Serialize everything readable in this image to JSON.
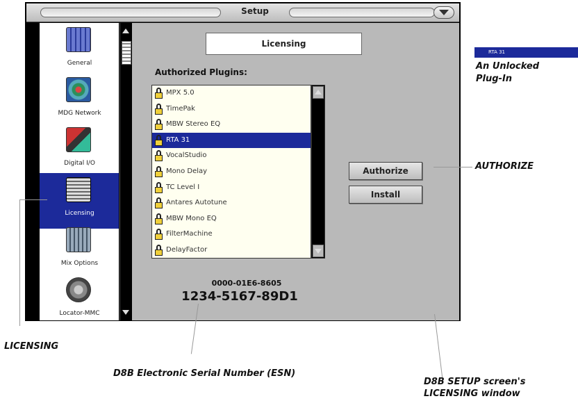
{
  "window": {
    "title": "Setup"
  },
  "sidebar": {
    "items": [
      {
        "label": "General",
        "icon": "general-icon"
      },
      {
        "label": "MDG Network",
        "icon": "network-icon"
      },
      {
        "label": "Digital I/O",
        "icon": "digital-io-icon"
      },
      {
        "label": "Licensing",
        "icon": "licensing-icon",
        "selected": true
      },
      {
        "label": "Mix Options",
        "icon": "mix-options-icon"
      },
      {
        "label": "Locator-MMC",
        "icon": "locator-icon"
      }
    ]
  },
  "main": {
    "heading": "Licensing",
    "authorized_label": "Authorized Plugins:",
    "plugins": [
      "MPX 5.0",
      "TimePak",
      "MBW Stereo EQ",
      "RTA 31",
      "VocalStudio",
      "Mono Delay",
      "TC Level I",
      "Antares Autotune",
      "MBW Mono EQ",
      "FilterMachine",
      "DelayFactor"
    ],
    "selected_plugin": "RTA 31",
    "buttons": {
      "authorize": "Authorize",
      "install": "Install"
    },
    "esn_small": "0000-01E6-8605",
    "esn_big": "1234-5167-89D1"
  },
  "callouts": {
    "unlocked_badge": "RTA 31",
    "unlocked_line1": "An Unlocked",
    "unlocked_line2": "Plug-In",
    "authorize": "AUTHORIZE",
    "licensing": "LICENSING",
    "esn": "D8B Electronic Serial Number (ESN)",
    "setup_line1": "D8B SETUP screen's",
    "setup_line2": "LICENSING window"
  },
  "colors": {
    "selection": "#1c2a9a",
    "panel": "#b9b9b9",
    "lock": "#f0d03a"
  }
}
